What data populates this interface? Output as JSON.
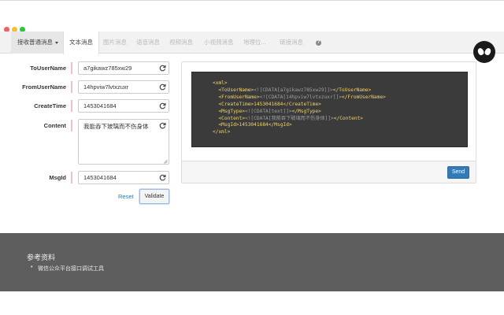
{
  "tabs": {
    "dropdown_label": "接收普通消息",
    "items": [
      "文本消息",
      "图片消息",
      "语音消息",
      "视频消息",
      "小视频消息",
      "地理位...",
      "链接消息"
    ]
  },
  "form": {
    "fields": [
      {
        "label": "ToUserName",
        "value": "a7gikawz785xw29"
      },
      {
        "label": "FromUserName",
        "value": "14hpviw7lvtxzuxr"
      },
      {
        "label": "CreateTime",
        "value": "1453041684"
      },
      {
        "label": "Content",
        "value": "我能吞下玻璃而不伤身体"
      },
      {
        "label": "MsgId",
        "value": "1453041684"
      }
    ],
    "reset_label": "Reset",
    "validate_label": "Validate"
  },
  "xml": {
    "open": "<xml>",
    "close": "</xml>",
    "lines": [
      {
        "open": "<ToUserName>",
        "body": "<![CDATA[a7gikawz785xw29]]>",
        "close": "</ToUserName>",
        "cdata": true
      },
      {
        "open": "<FromUserName>",
        "body": "<![CDATA[14hpviw7lvtxzuxr]]>",
        "close": "</FromUserName>",
        "cdata": true
      },
      {
        "open": "<CreateTime>",
        "body": "1453041684",
        "close": "</CreateTime>",
        "cdata": false
      },
      {
        "open": "<MsgType>",
        "body": "<![CDATA[text]]>",
        "close": "</MsgType>",
        "cdata": true
      },
      {
        "open": "<Content>",
        "body": "<![CDATA[我能吞下玻璃而不伤身体]]>",
        "close": "</Content>",
        "cdata": true
      },
      {
        "open": "<MsgId>",
        "body": "1453041684",
        "close": "</MsgId>",
        "cdata": false
      }
    ]
  },
  "send_label": "Send",
  "footer": {
    "title": "参考资料",
    "items": [
      "微信公众平台接口调试工具"
    ]
  },
  "colors": {
    "primary": "#337ab7",
    "footer_bg": "#5e5e5e",
    "code_bg": "#3b3b3b",
    "code_tag": "#f0d36a"
  },
  "icons": {
    "field_action": "refresh-icon",
    "help": "question-circle-icon",
    "extension": "alien-icon"
  }
}
